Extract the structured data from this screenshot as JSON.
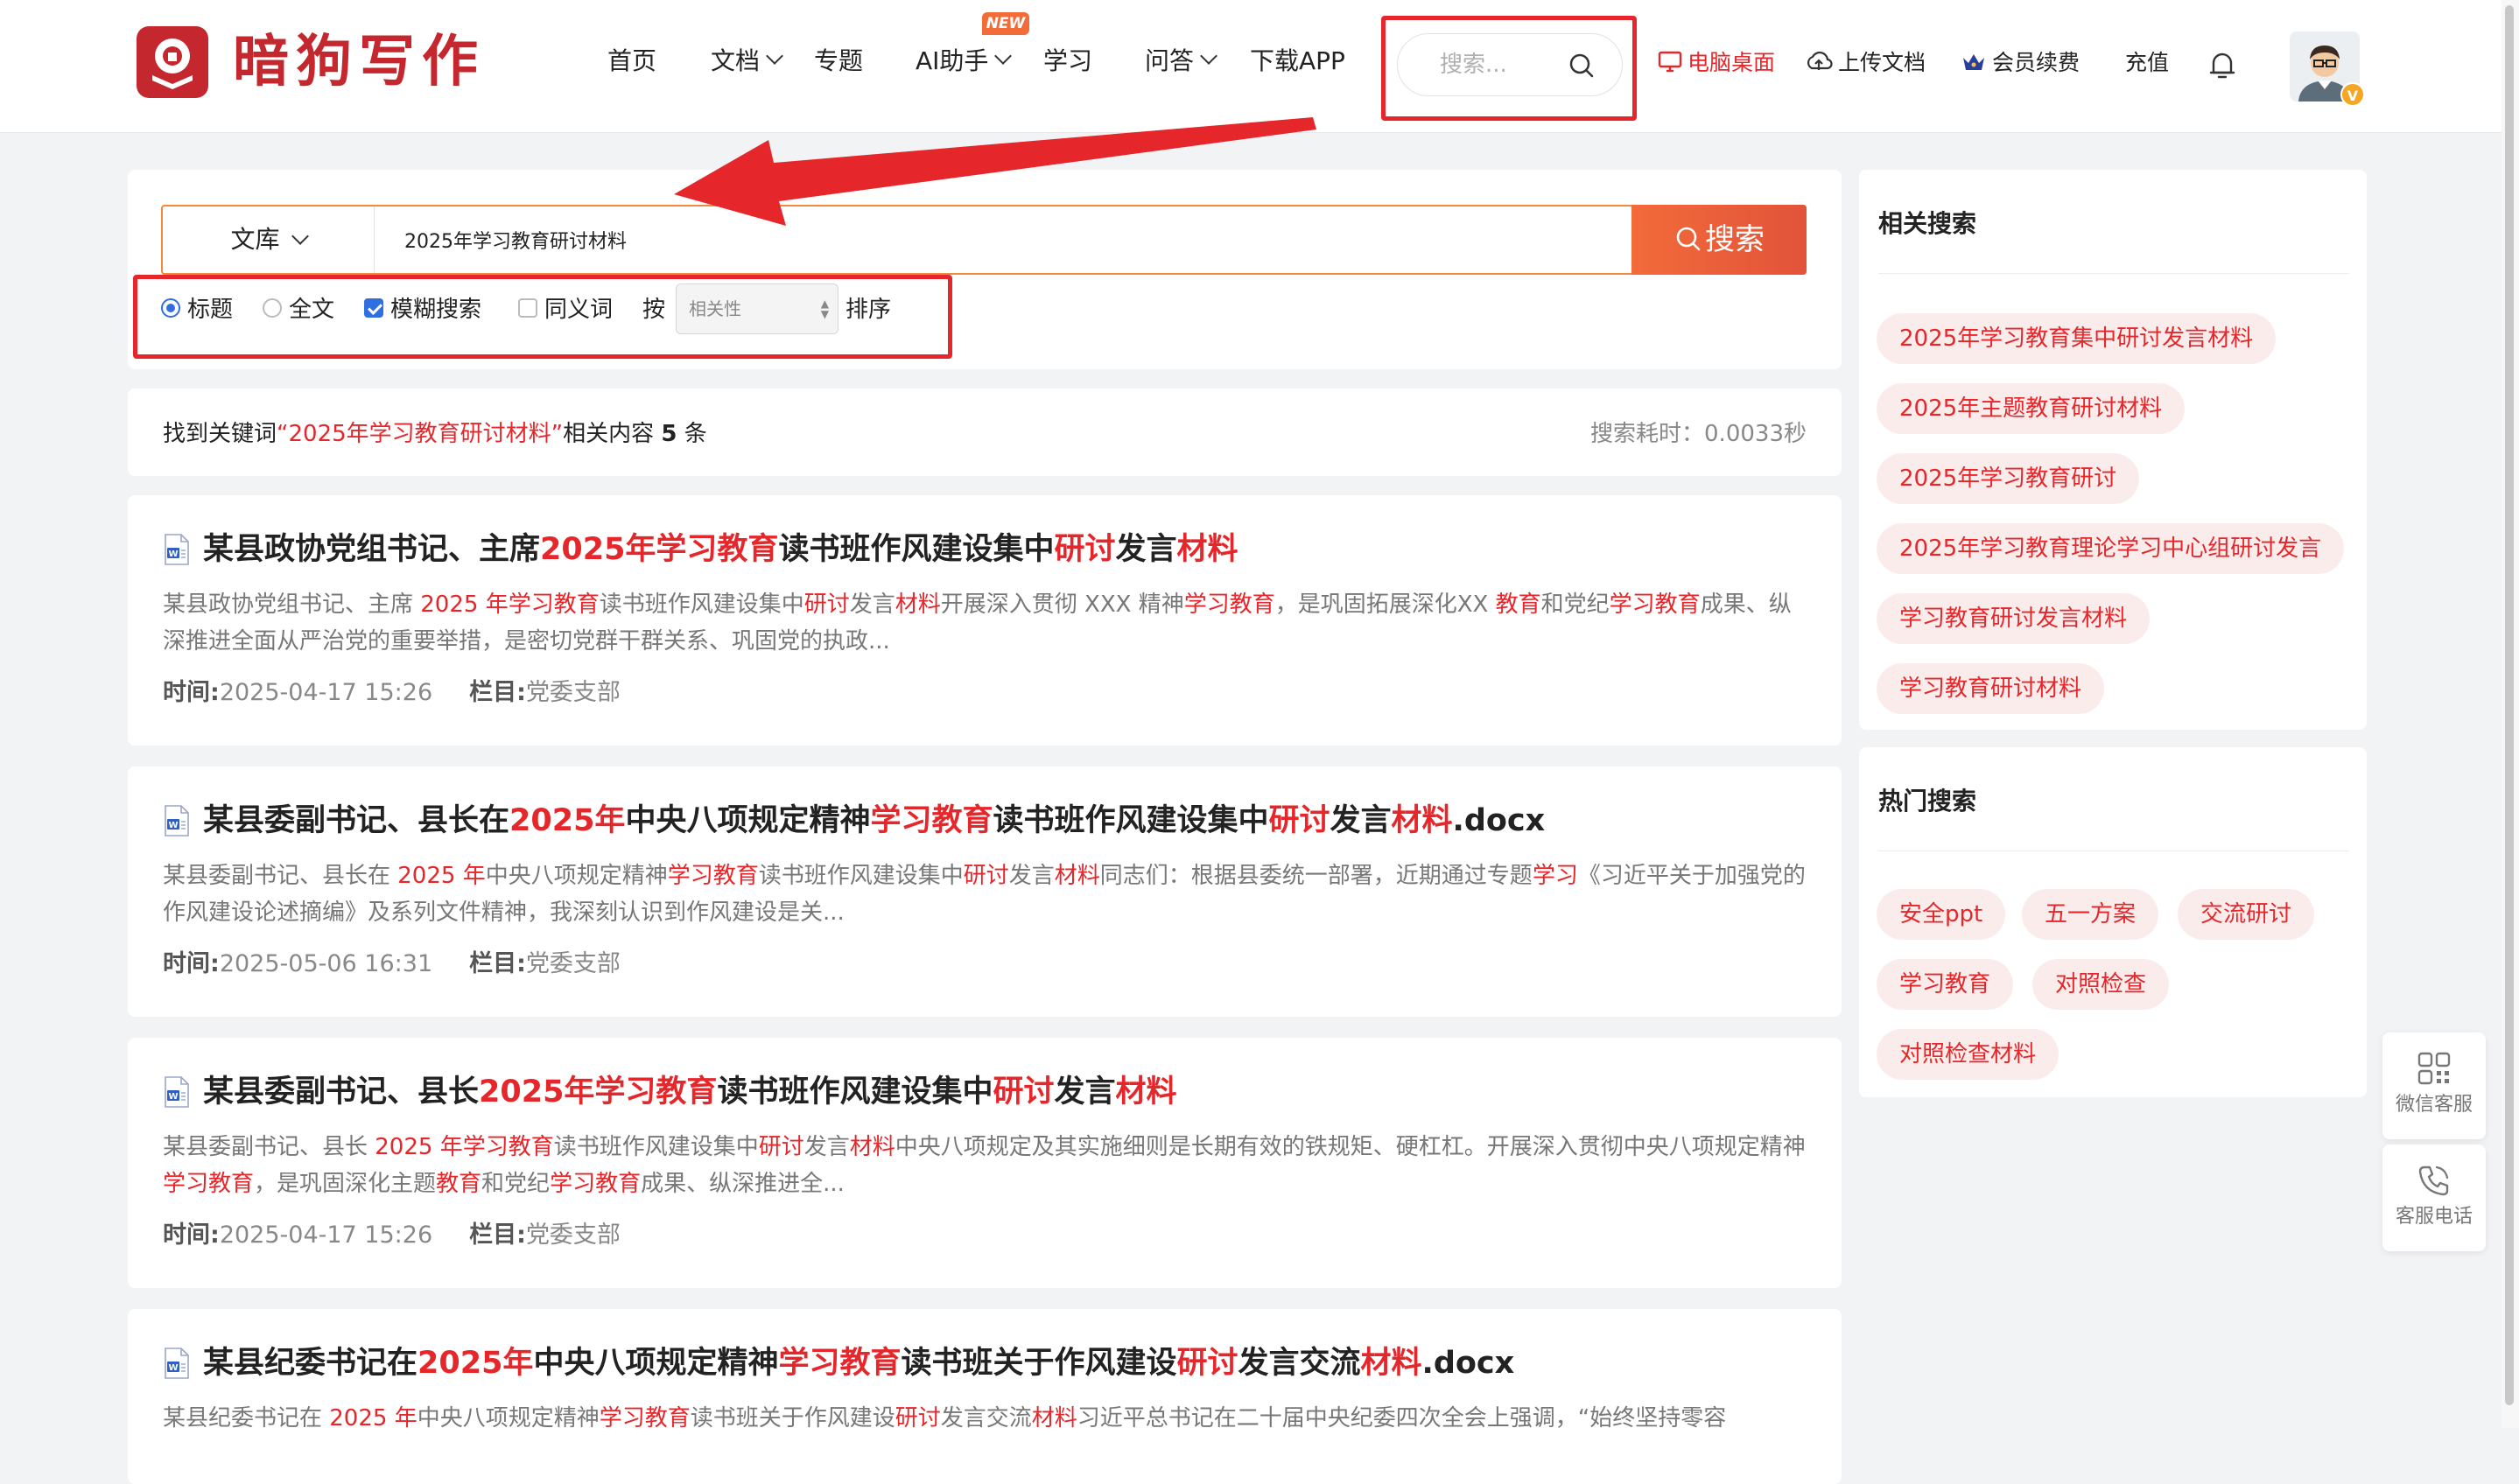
{
  "header": {
    "logo_text": "暗狗写作",
    "nav": [
      {
        "label": "首页",
        "dropdown": false
      },
      {
        "label": "文档",
        "dropdown": true
      },
      {
        "label": "专题",
        "dropdown": false
      },
      {
        "label": "AI助手",
        "dropdown": true
      },
      {
        "label": "学习",
        "dropdown": false
      },
      {
        "label": "问答",
        "dropdown": true
      },
      {
        "label": "下载APP",
        "dropdown": false
      }
    ],
    "new_badge": "NEW",
    "search_placeholder": "搜索...",
    "links": {
      "desktop": "电脑桌面",
      "upload": "上传文档",
      "vip": "会员续费",
      "recharge": "充值"
    },
    "avatar_badge": "V"
  },
  "search": {
    "scope": "文库",
    "query": "2025年学习教育研讨材料",
    "button": "搜索",
    "options": {
      "title": "标题",
      "fulltext": "全文",
      "fuzzy": "模糊搜索",
      "synonym": "同义词",
      "sort_prefix": "按",
      "sort_value": "相关性",
      "sort_suffix": "排序"
    }
  },
  "summary": {
    "prefix": "找到关键词",
    "keyword": "“2025年学习教育研讨材料”",
    "middle": "相关内容",
    "count": "5",
    "suffix": "条",
    "elapsed": "搜索耗时：0.0033秒"
  },
  "results": [
    {
      "title": [
        [
          "某县政协党组书记、主席",
          0
        ],
        [
          "2025年学习教育",
          1
        ],
        [
          "读书班作风建设集中",
          0
        ],
        [
          "研讨",
          1
        ],
        [
          "发言",
          0
        ],
        [
          "材料",
          1
        ]
      ],
      "snippet": [
        [
          "某县政协党组书记、主席 ",
          0
        ],
        [
          "2025 年学习教育",
          1
        ],
        [
          "读书班作风建设集中",
          0
        ],
        [
          "研讨",
          1
        ],
        [
          "发言",
          0
        ],
        [
          "材料",
          1
        ],
        [
          "开展深入贯彻 XXX 精神",
          0
        ],
        [
          "学习教育",
          1
        ],
        [
          "，是巩固拓展深化XX ",
          0
        ],
        [
          "教育",
          1
        ],
        [
          "和党纪",
          0
        ],
        [
          "学习教育",
          1
        ],
        [
          "成果、纵深推进全面从严治党的重要举措，是密切党群干群关系、巩固党的执政...",
          0
        ]
      ],
      "time_label": "时间:",
      "time": "2025-04-17 15:26",
      "cat_label": "栏目:",
      "category": "党委支部"
    },
    {
      "title": [
        [
          "某县委副书记、县长在",
          0
        ],
        [
          "2025年",
          1
        ],
        [
          "中央八项规定精神",
          0
        ],
        [
          "学习教育",
          1
        ],
        [
          "读书班作风建设集中",
          0
        ],
        [
          "研讨",
          1
        ],
        [
          "发言",
          0
        ],
        [
          "材料",
          1
        ],
        [
          ".docx",
          0
        ]
      ],
      "snippet": [
        [
          "某县委副书记、县长在 ",
          0
        ],
        [
          "2025 年",
          1
        ],
        [
          "中央八项规定精神",
          0
        ],
        [
          "学习教育",
          1
        ],
        [
          "读书班作风建设集中",
          0
        ],
        [
          "研讨",
          1
        ],
        [
          "发言",
          0
        ],
        [
          "材料",
          1
        ],
        [
          "同志们：根据县委统一部署，近期通过专题",
          0
        ],
        [
          "学习",
          1
        ],
        [
          "《习近平关于加强党的作风建设论述摘编》及系列文件精神，我深刻认识到作风建设是关...",
          0
        ]
      ],
      "time_label": "时间:",
      "time": "2025-05-06 16:31",
      "cat_label": "栏目:",
      "category": "党委支部"
    },
    {
      "title": [
        [
          "某县委副书记、县长",
          0
        ],
        [
          "2025年学习教育",
          1
        ],
        [
          "读书班作风建设集中",
          0
        ],
        [
          "研讨",
          1
        ],
        [
          "发言",
          0
        ],
        [
          "材料",
          1
        ]
      ],
      "snippet": [
        [
          "某县委副书记、县长 ",
          0
        ],
        [
          "2025 年学习教育",
          1
        ],
        [
          "读书班作风建设集中",
          0
        ],
        [
          "研讨",
          1
        ],
        [
          "发言",
          0
        ],
        [
          "材料",
          1
        ],
        [
          "中央八项规定及其实施细则是长期有效的铁规矩、硬杠杠。开展深入贯彻中央八项规定精神",
          0
        ],
        [
          "学习教育",
          1
        ],
        [
          "，是巩固深化主题",
          0
        ],
        [
          "教育",
          1
        ],
        [
          "和党纪",
          0
        ],
        [
          "学习教育",
          1
        ],
        [
          "成果、纵深推进全...",
          0
        ]
      ],
      "time_label": "时间:",
      "time": "2025-04-17 15:26",
      "cat_label": "栏目:",
      "category": "党委支部"
    },
    {
      "title": [
        [
          "某县纪委书记在",
          0
        ],
        [
          "2025年",
          1
        ],
        [
          "中央八项规定精神",
          0
        ],
        [
          "学习教育",
          1
        ],
        [
          "读书班关于作风建设",
          0
        ],
        [
          "研讨",
          1
        ],
        [
          "发言交流",
          0
        ],
        [
          "材料",
          1
        ],
        [
          ".docx",
          0
        ]
      ],
      "snippet": [
        [
          "某县纪委书记在 ",
          0
        ],
        [
          "2025 年",
          1
        ],
        [
          "中央八项规定精神",
          0
        ],
        [
          "学习教育",
          1
        ],
        [
          "读书班关于作风建设",
          0
        ],
        [
          "研讨",
          1
        ],
        [
          "发言交流",
          0
        ],
        [
          "材料",
          1
        ],
        [
          "习近平总书记在二十届中央纪委四次全会上强调，“始终坚持零容",
          0
        ]
      ],
      "time_label": "",
      "time": "",
      "cat_label": "",
      "category": ""
    }
  ],
  "sidebar": {
    "related_title": "相关搜索",
    "related": [
      "2025年学习教育集中研讨发言材料",
      "2025年主题教育研讨材料",
      "2025年学习教育研讨",
      "2025年学习教育理论学习中心组研讨发言",
      "学习教育研讨发言材料",
      "学习教育研讨材料"
    ],
    "hot_title": "热门搜索",
    "hot": [
      "安全ppt",
      "五一方案",
      "交流研讨",
      "学习教育",
      "对照检查",
      "对照检查材料"
    ]
  },
  "float": {
    "wechat": "微信客服",
    "phone": "客服电话"
  },
  "colors": {
    "brand_red": "#c4282e",
    "highlight": "#e5272b",
    "search_orange": "#f26b3a",
    "annotation_red": "#e5272b"
  }
}
